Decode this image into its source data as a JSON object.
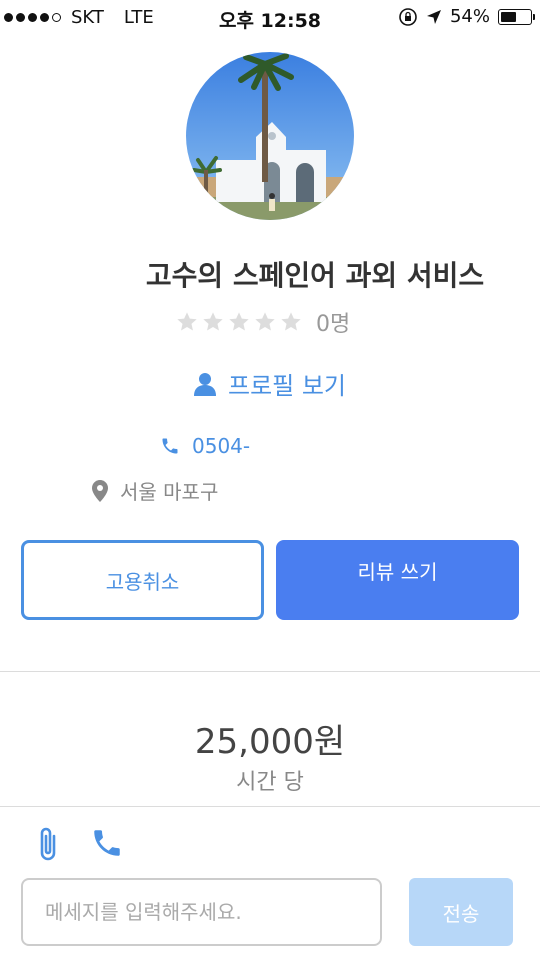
{
  "status_bar": {
    "carrier": "SKT",
    "network": "LTE",
    "time": "오후 12:58",
    "battery_percent": "54%",
    "battery_level": 0.54,
    "icons": [
      "rotation-lock-icon",
      "location-arrow-icon",
      "battery-icon"
    ]
  },
  "profile": {
    "service_title": "고수의 스페인어 과외 서비스",
    "rating": {
      "stars_filled": 0,
      "stars_total": 5,
      "review_count": "0명"
    },
    "profile_link_label": "프로필 보기",
    "phone": "0504-",
    "location": "서울 마포구"
  },
  "actions": {
    "cancel_label": "고용취소",
    "review_label": "리뷰 쓰기"
  },
  "pricing": {
    "price": "25,000원",
    "unit": "시간 당"
  },
  "composer": {
    "placeholder": "메세지를 입력해주세요.",
    "value": "",
    "send_label": "전송"
  },
  "colors": {
    "accent": "#4a90e2",
    "primary_button": "#4a7ef0",
    "send_disabled": "#b7d7f8",
    "star_empty": "#dddddd"
  }
}
